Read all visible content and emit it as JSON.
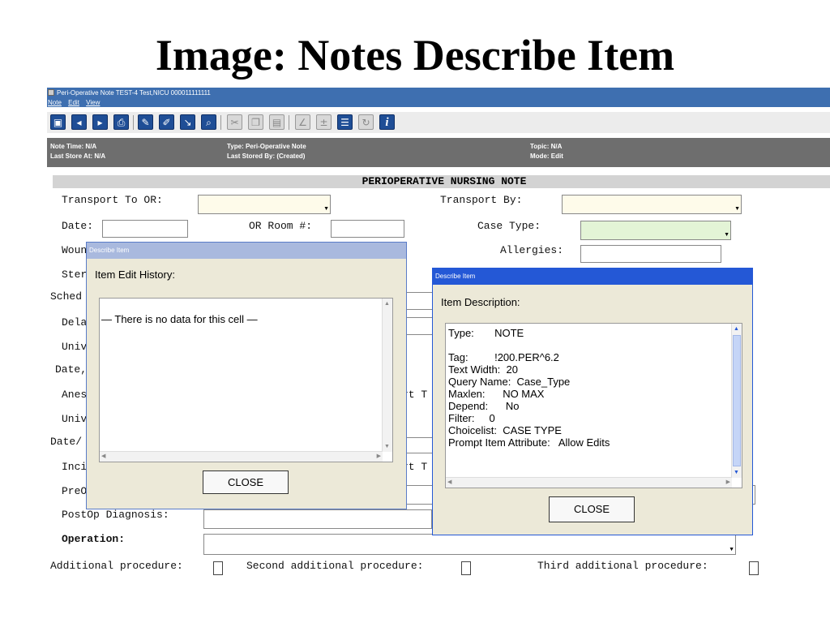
{
  "slide": {
    "title": "Image: Notes Describe Item"
  },
  "window": {
    "title": "Peri-Operative Note    TEST-4     Test,NICU    000011111111"
  },
  "menu": {
    "items": [
      "Note",
      "Edit",
      "View"
    ]
  },
  "toolbar": {
    "icons": [
      "save-icon",
      "back-icon",
      "forward-icon",
      "print-icon",
      "note-icon",
      "edit-note-icon",
      "sort-icon",
      "find-icon",
      "cut-icon",
      "copy-icon",
      "paste-icon",
      "sign-icon",
      "add-icon",
      "list-icon",
      "refresh-icon",
      "info-icon"
    ]
  },
  "info": {
    "note_time": "Note Time:   N/A",
    "last_store": "Last Store At:  N/A",
    "type": "Type:    Peri-Operative Note",
    "last_stored_by": "Last Stored By:  (Created)",
    "topic": "Topic:  N/A",
    "mode": "Mode:  Edit"
  },
  "form": {
    "header": "PERIOPERATIVE NURSING NOTE",
    "transport_to_or": "Transport To OR:",
    "transport_by": "Transport By:",
    "date": "Date:",
    "or_room": "OR Room #:",
    "case_type": "Case Type:",
    "wound_partial": "Woun",
    "allergies": "Allergies:",
    "ster_partial": "Ster",
    "sched_partial": "Sched",
    "dela_partial": "Dela",
    "univ1_partial": "Univ",
    "date2_partial": "Date,",
    "anes_partial": "Anes",
    "univ2_partial": "Univ",
    "date3_partial": "Date/",
    "inci_partial": "Inci",
    "preo_partial": "PreO",
    "rt_t_1": "rt T",
    "rt_t_2": "rt T",
    "postop_diagnosis": "PostOp Diagnosis:",
    "operation": "Operation:",
    "additional_procedure": "Additional procedure:",
    "second_additional_procedure": "Second additional procedure:",
    "third_additional_procedure": "Third additional procedure:"
  },
  "dialog_history": {
    "title": "Describe Item",
    "heading": "Item Edit History:",
    "text": "— There is no data for this cell —",
    "close": "CLOSE"
  },
  "dialog_description": {
    "title": "Describe Item",
    "heading": "Item Description:",
    "lines": [
      "Type:       NOTE",
      "",
      "Tag:         !200.PER^6.2",
      "Text Width:  20",
      "Query Name:  Case_Type",
      "Maxlen:      NO MAX",
      "Depend:      No",
      "Filter:     0",
      "Choicelist:  CASE TYPE",
      "Prompt Item Attribute:   Allow Edits"
    ],
    "close": "CLOSE"
  }
}
